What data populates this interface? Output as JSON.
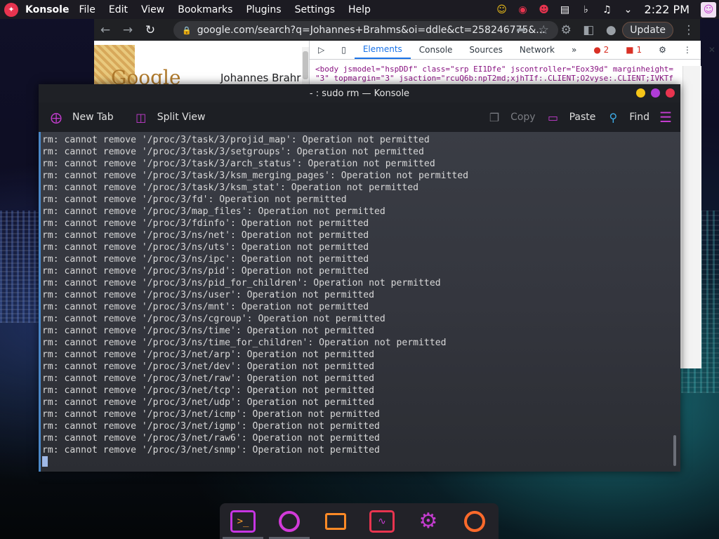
{
  "panel": {
    "app_name": "Konsole",
    "menu": [
      "File",
      "Edit",
      "View",
      "Bookmarks",
      "Plugins",
      "Settings",
      "Help"
    ],
    "clock": "2:22 PM"
  },
  "chrome": {
    "url": "google.com/search?q=Johannes+Brahms&oi=ddle&ct=258246775&...",
    "update_label": "Update",
    "page_query": "Johannes Brahr",
    "google_label": "Google",
    "devtools": {
      "tabs": [
        "Elements",
        "Console",
        "Sources",
        "Network"
      ],
      "active_tab": "Elements",
      "errors": "2",
      "warnings": "1",
      "code_line1": "<body jsmodel=\"hspDDf\" class=\"srp EI1Dfe\" jscontroller=\"Eox39d\" marginheight=",
      "code_line2": "\"3\" topmargin=\"3\" jsaction=\"rcuQ6b:npT2md;xjhTIf:.CLIENT;O2vyse:.CLIENT;IVKTf"
    }
  },
  "konsole": {
    "title": "- : sudo rm — Konsole",
    "toolbar": {
      "new_tab": "New Tab",
      "split_view": "Split View",
      "copy": "Copy",
      "paste": "Paste",
      "find": "Find"
    },
    "terminal_lines": [
      "rm: cannot remove '/proc/3/task/3/projid_map': Operation not permitted",
      "rm: cannot remove '/proc/3/task/3/setgroups': Operation not permitted",
      "rm: cannot remove '/proc/3/task/3/arch_status': Operation not permitted",
      "rm: cannot remove '/proc/3/task/3/ksm_merging_pages': Operation not permitted",
      "rm: cannot remove '/proc/3/task/3/ksm_stat': Operation not permitted",
      "rm: cannot remove '/proc/3/fd': Operation not permitted",
      "rm: cannot remove '/proc/3/map_files': Operation not permitted",
      "rm: cannot remove '/proc/3/fdinfo': Operation not permitted",
      "rm: cannot remove '/proc/3/ns/net': Operation not permitted",
      "rm: cannot remove '/proc/3/ns/uts': Operation not permitted",
      "rm: cannot remove '/proc/3/ns/ipc': Operation not permitted",
      "rm: cannot remove '/proc/3/ns/pid': Operation not permitted",
      "rm: cannot remove '/proc/3/ns/pid_for_children': Operation not permitted",
      "rm: cannot remove '/proc/3/ns/user': Operation not permitted",
      "rm: cannot remove '/proc/3/ns/mnt': Operation not permitted",
      "rm: cannot remove '/proc/3/ns/cgroup': Operation not permitted",
      "rm: cannot remove '/proc/3/ns/time': Operation not permitted",
      "rm: cannot remove '/proc/3/ns/time_for_children': Operation not permitted",
      "rm: cannot remove '/proc/3/net/arp': Operation not permitted",
      "rm: cannot remove '/proc/3/net/dev': Operation not permitted",
      "rm: cannot remove '/proc/3/net/raw': Operation not permitted",
      "rm: cannot remove '/proc/3/net/tcp': Operation not permitted",
      "rm: cannot remove '/proc/3/net/udp': Operation not permitted",
      "rm: cannot remove '/proc/3/net/icmp': Operation not permitted",
      "rm: cannot remove '/proc/3/net/igmp': Operation not permitted",
      "rm: cannot remove '/proc/3/net/raw6': Operation not permitted",
      "rm: cannot remove '/proc/3/net/snmp': Operation not permitted"
    ]
  },
  "colors": {
    "accent": "#c43ccf",
    "title_btn_yellow": "#f5c518",
    "title_btn_purple": "#b03cd8",
    "title_btn_red": "#e8344f"
  },
  "icons": [
    "konsole-icon",
    "chrome-icon",
    "dolphin-icon",
    "system-monitor-icon",
    "settings-icon",
    "firefox-icon"
  ]
}
